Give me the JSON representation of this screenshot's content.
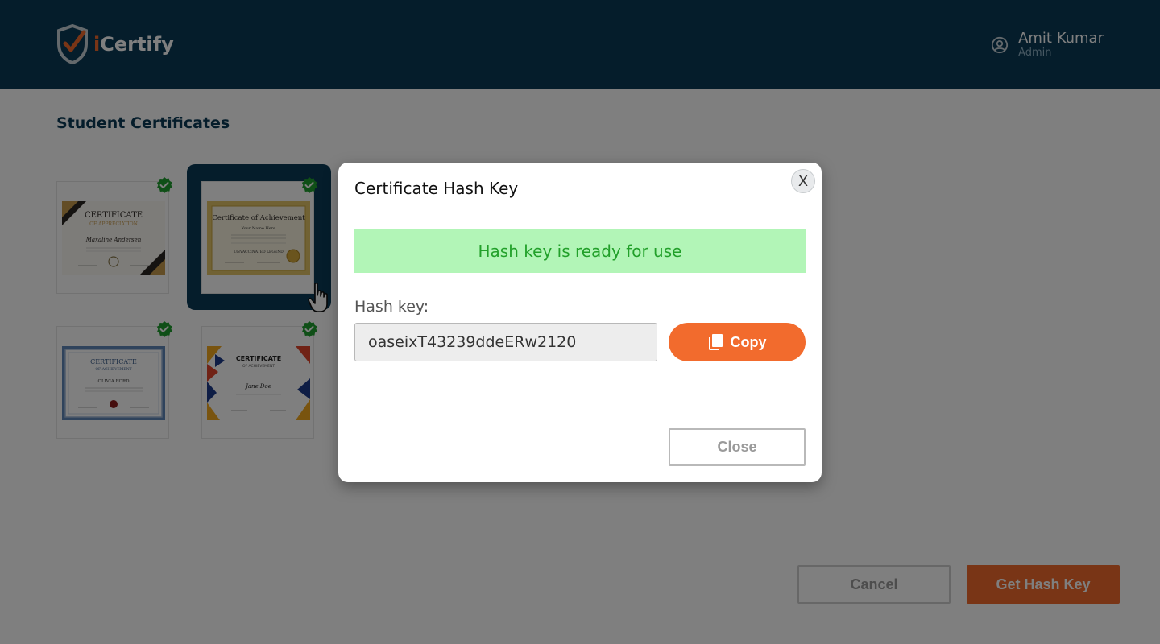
{
  "header": {
    "brand_prefix": "i",
    "brand_name": "Certify",
    "user": {
      "name": "Amit Kumar",
      "role": "Admin"
    }
  },
  "page": {
    "title": "Student Certificates",
    "certificates": [
      {
        "title": "CERTIFICATE",
        "subtitle": "OF APPRECIATION",
        "recipient": "Maxaline Andersen",
        "verified": true,
        "selected": false
      },
      {
        "title": "Certificate of Achievement",
        "recipient": "Your Name Here",
        "note": "UNVACCINATED LEGEND",
        "verified": true,
        "selected": true
      },
      {
        "title": "CERTIFICATE",
        "subtitle": "OF ACHIEVEMENT",
        "recipient": "OLIVIA FORD",
        "verified": true,
        "selected": false
      },
      {
        "title": "CERTIFICATE",
        "subtitle": "OF ACHIEVEMENT",
        "recipient": "Jane Doe",
        "verified": true,
        "selected": false
      }
    ],
    "cancel_label": "Cancel",
    "get_hash_label": "Get Hash Key"
  },
  "modal": {
    "title": "Certificate Hash Key",
    "close_x_label": "X",
    "alert": "Hash key is ready for use",
    "hash_label": "Hash key:",
    "hash_value": "oaseixT43239ddeERw2120",
    "copy_label": "Copy",
    "close_label": "Close"
  },
  "colors": {
    "header_bg": "#0b3b57",
    "accent": "#f26b2d",
    "success_bg": "#b2f5b7",
    "success_text": "#22a02a",
    "verified": "#1e9e2e"
  }
}
